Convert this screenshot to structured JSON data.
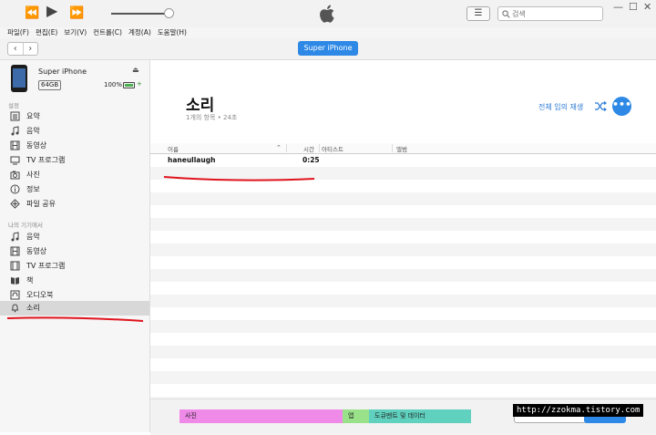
{
  "colors": {
    "accent": "#2e89e6",
    "annotation": "#e0141e"
  },
  "toolbar": {
    "rewind_icon": "rewind-icon",
    "play_icon": "play-icon",
    "forward_icon": "fast-forward-icon",
    "volume_fraction": 0.9,
    "search_placeholder": "검색"
  },
  "menu": [
    "파일(F)",
    "편집(E)",
    "보기(V)",
    "컨트롤(C)",
    "계정(A)",
    "도움말(H)"
  ],
  "nav": {
    "device_pill": "Super iPhone"
  },
  "device": {
    "name": "Super iPhone",
    "capacity": "64GB",
    "battery": "100%",
    "battery_fraction": 1.0
  },
  "sidebar": {
    "settings_header": "설정",
    "settings_items": [
      {
        "label": "요약",
        "icon": "summary-icon"
      },
      {
        "label": "음악",
        "icon": "music-icon"
      },
      {
        "label": "동영상",
        "icon": "film-icon"
      },
      {
        "label": "TV 프로그램",
        "icon": "tv-icon"
      },
      {
        "label": "사진",
        "icon": "camera-icon"
      },
      {
        "label": "정보",
        "icon": "info-icon"
      },
      {
        "label": "파일 공유",
        "icon": "apps-icon"
      }
    ],
    "device_header": "나의 기기에서",
    "device_items": [
      {
        "label": "음악",
        "icon": "music-icon"
      },
      {
        "label": "동영상",
        "icon": "film-icon"
      },
      {
        "label": "TV 프로그램",
        "icon": "tv-icon"
      },
      {
        "label": "책",
        "icon": "book-icon"
      },
      {
        "label": "오디오북",
        "icon": "audiobook-icon"
      },
      {
        "label": "소리",
        "icon": "bell-icon",
        "selected": true
      }
    ]
  },
  "main": {
    "title": "소리",
    "subtitle": "1개의 항목 • 24초",
    "shuffle_label": "전체 임의 재생",
    "more_label": "•••"
  },
  "table": {
    "columns": [
      "이름",
      "시간",
      "아티스트",
      "앨범"
    ],
    "rows": [
      {
        "name": "haneullaugh",
        "time": "0:25",
        "artist": "",
        "album": ""
      }
    ]
  },
  "footer": {
    "segments": [
      {
        "label": "사진",
        "color": "#f08ae9",
        "fraction": 0.56
      },
      {
        "label": "앱",
        "color": "#9ae28a",
        "fraction": 0.09
      },
      {
        "label": "도큐멘트 및 데이터",
        "color": "#5fd1be",
        "fraction": 0.35
      }
    ]
  },
  "watermark": "http://zzokma.tistory.com"
}
